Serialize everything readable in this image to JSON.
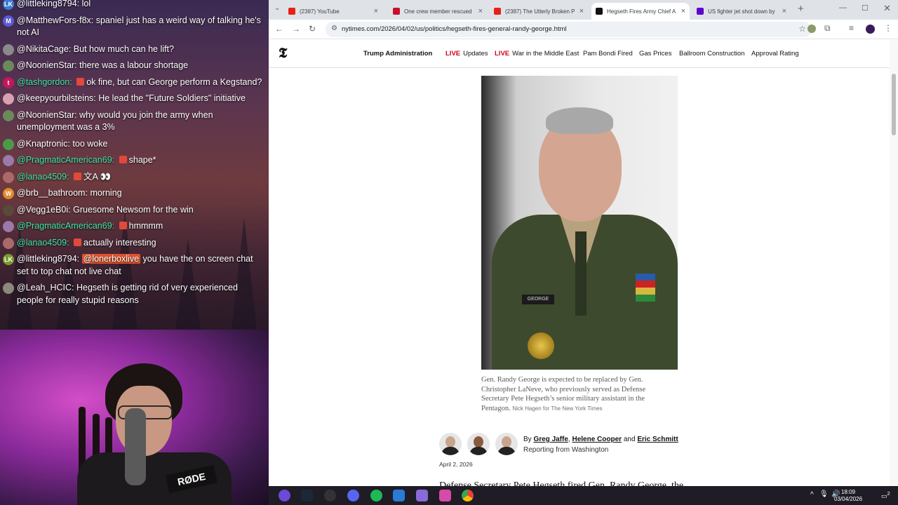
{
  "chat": {
    "messages": [
      {
        "user": "@littleking8794:",
        "text": "lol",
        "avatar_color": "#3a7bd5",
        "avatar_letter": "LK"
      },
      {
        "user": "@MatthewFors-f8x:",
        "text": "spaniel just has a weird way of talking he's not AI",
        "avatar_color": "#5b5bd6",
        "avatar_letter": "M"
      },
      {
        "user": "@NikitaCage:",
        "text": "But how much can he lift?",
        "avatar_color": "#8a8a8a",
        "avatar_letter": ""
      },
      {
        "user": "@NoonienStar:",
        "text": "there was a labour shortage",
        "avatar_color": "#6a8a5a",
        "avatar_letter": ""
      },
      {
        "user": "@tashgordon:",
        "text": "ok fine, but can George perform a Kegstand?",
        "avatar_color": "#c2185b",
        "avatar_letter": "t",
        "green": true,
        "emote": true
      },
      {
        "user": "@keepyourbilsteins:",
        "text": "He lead the \"Future Soldiers\" initiative",
        "avatar_color": "#d9a0b0",
        "avatar_letter": ""
      },
      {
        "user": "@NoonienStar:",
        "text": "why would you join the army when unemployment was a 3%",
        "avatar_color": "#6a8a5a",
        "avatar_letter": ""
      },
      {
        "user": "@Knaptronic:",
        "text": "too woke",
        "avatar_color": "#4a9a4a",
        "avatar_letter": ""
      },
      {
        "user": "@PragmaticAmerican69:",
        "text": "shape*",
        "avatar_color": "#9a7aaa",
        "avatar_letter": "",
        "green": true,
        "emote": true
      },
      {
        "user": "@lanao4509:",
        "text": "文A 👀",
        "avatar_color": "#aa6a6a",
        "avatar_letter": "",
        "green": true,
        "emote": true
      },
      {
        "user": "@brb__bathroom:",
        "text": "morning",
        "avatar_color": "#e08a2a",
        "avatar_letter": "W"
      },
      {
        "user": "@Vegg1eB0i:",
        "text": "Gruesome Newsom for the win",
        "avatar_color": "#5a4a3a",
        "avatar_letter": ""
      },
      {
        "user": "@PragmaticAmerican69:",
        "text": "hmmmm",
        "avatar_color": "#9a7aaa",
        "avatar_letter": "",
        "green": true,
        "emote": true
      },
      {
        "user": "@lanao4509:",
        "text": "actually interesting",
        "avatar_color": "#aa6a6a",
        "avatar_letter": "",
        "green": true,
        "emote": true
      },
      {
        "user": "@littleking8794:",
        "mention": "@lonerboxlive",
        "text": "you have the on screen chat set to top chat not live chat",
        "avatar_color": "#7a9a2a",
        "avatar_letter": "LK"
      },
      {
        "user": "@Leah_HCIC:",
        "text": "Hegseth is getting rid of very experienced people for really stupid reasons",
        "avatar_color": "#8a8a7a",
        "avatar_letter": ""
      }
    ]
  },
  "webcam": {
    "mic_brand": "RØDE"
  },
  "browser": {
    "tabs": [
      {
        "title": "(2387) YouTube",
        "icon": "youtube-icon",
        "color": "#e62117"
      },
      {
        "title": "One crew member rescued",
        "icon": "news-icon",
        "color": "#c8102e"
      },
      {
        "title": "(2387) The Utterly Broken P",
        "icon": "youtube-icon",
        "color": "#e62117"
      },
      {
        "title": "Hegseth Fires Army Chief A",
        "icon": "nyt-icon",
        "color": "#121212",
        "active": true
      },
      {
        "title": "US fighter jet shot down by",
        "icon": "yahoo-icon",
        "color": "#5f01d1"
      }
    ],
    "url": "nytimes.com/2026/04/02/us/politics/hegseth-fires-general-randy-george.html"
  },
  "article": {
    "logo": "𝕿",
    "nav": {
      "section": "Trump Administration",
      "live_label": "LIVE",
      "live_1": "Updates",
      "live_2": "War in the Middle East",
      "item_1": "Pam Bondi Fired",
      "item_2": "Gas Prices",
      "item_3": "Ballroom Construction",
      "item_4": "Approval Rating"
    },
    "photo_nametag": "GEORGE",
    "caption": "Gen. Randy George is expected to be replaced by Gen. Christopher LaNeve, who previously served as Defense Secretary Pete Hegseth’s senior military assistant in the Pentagon.",
    "credit": "Nick Hagen for The New York Times",
    "byline_prefix": "By",
    "authors": [
      "Greg Jaffe",
      "Helene Cooper",
      "Eric Schmitt"
    ],
    "byline_sep": ",",
    "byline_and": "and",
    "location": "Reporting from Washington",
    "date": "April 2, 2026",
    "lede": "Defense Secretary Pete Hegseth fired Gen. Randy George, the"
  },
  "taskbar": {
    "time": "18:09",
    "date": "03/04/2026",
    "notifications": "2"
  }
}
